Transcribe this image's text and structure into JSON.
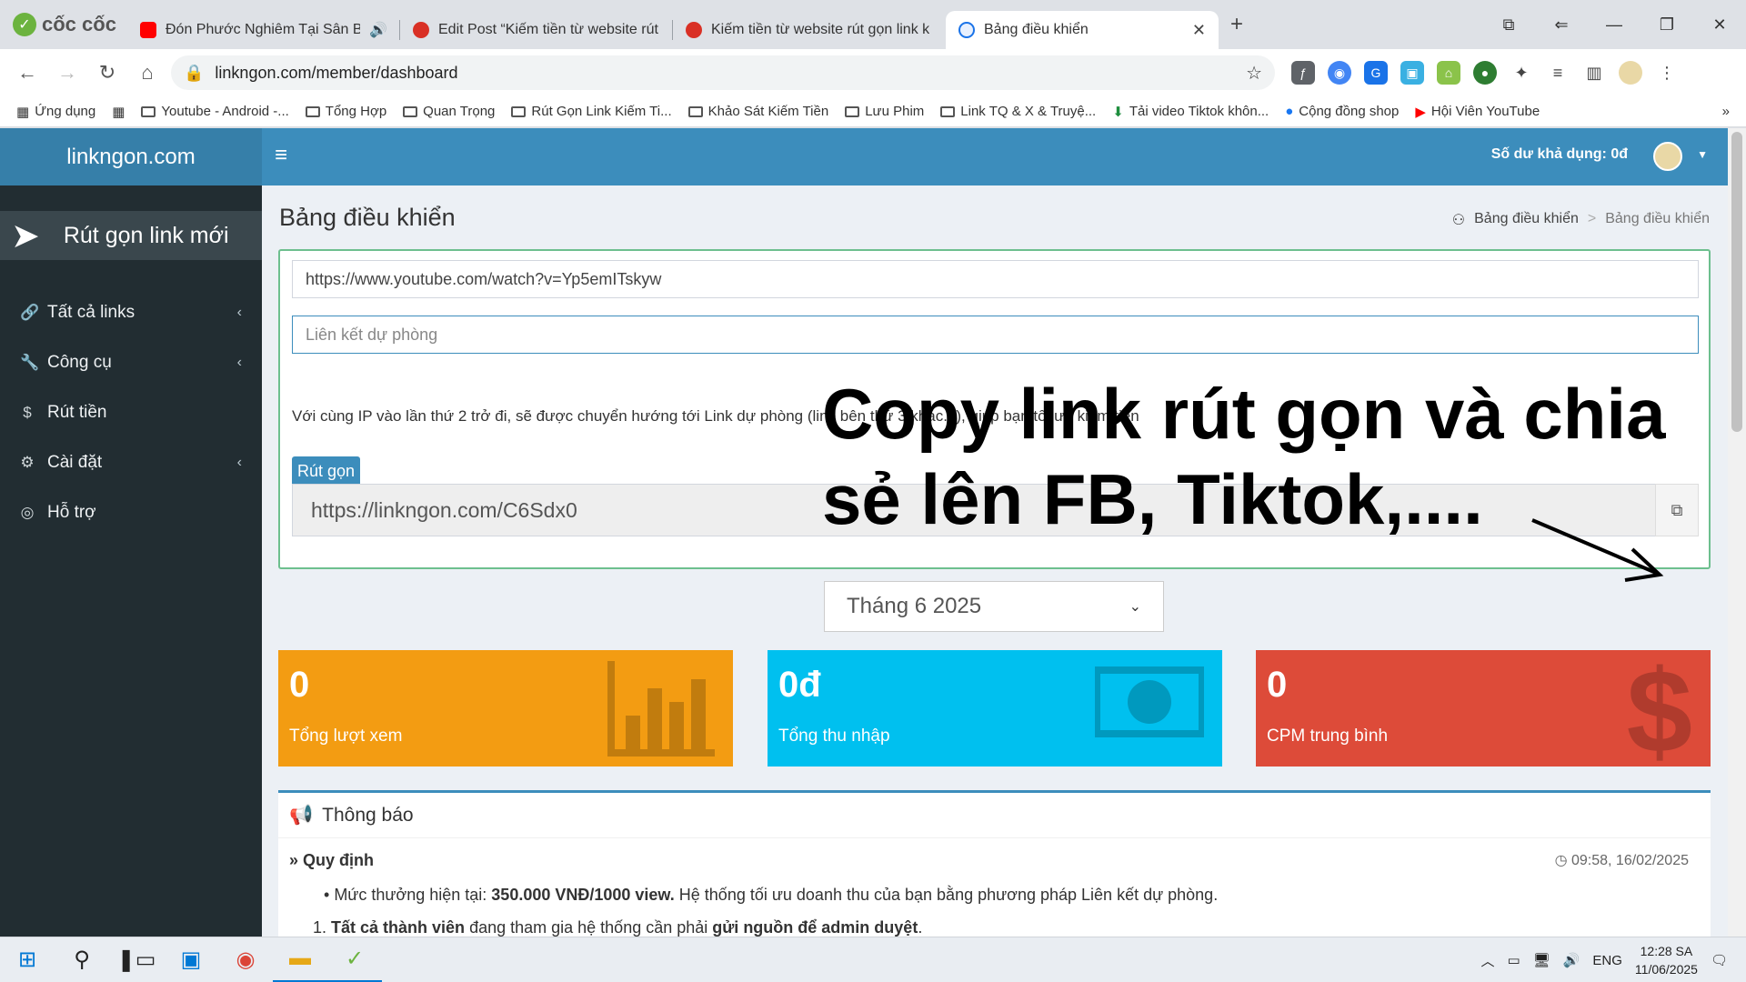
{
  "browser": {
    "logo_text": "cốc cốc",
    "tabs": [
      {
        "title": "Đón Phước Nghiêm Tại Sân Ba",
        "fav_color": "#ff0000"
      },
      {
        "title": "Edit Post “Kiếm tiền từ website rút",
        "fav_color": "#d93025"
      },
      {
        "title": "Kiếm tiền từ website rút gọn link k",
        "fav_color": "#d93025"
      },
      {
        "title": "Bảng điều khiển",
        "fav_color": "#1a73e8"
      }
    ],
    "url": "linkngon.com/member/dashboard",
    "bookmarks": [
      "Ứng dụng",
      "Youtube - Android -...",
      "Tổng Hợp",
      "Quan Trọng",
      "Rút Gọn Link Kiếm Ti...",
      "Khảo Sát Kiếm Tiền",
      "Lưu Phim",
      "Link TQ & X & Truyệ...",
      "Tải video Tiktok khôn...",
      "Cộng đồng shop",
      "Hội Viên YouTube"
    ]
  },
  "site": {
    "brand": "linkngon.com",
    "balance": "Số dư khả dụng: 0đ"
  },
  "sidebar": {
    "new_link": "Rút gọn link mới",
    "items": [
      {
        "label": "Tất cả links",
        "icon": "link-icon",
        "glyph": "🔗",
        "chevron": true
      },
      {
        "label": "Công cụ",
        "icon": "wrench-icon",
        "glyph": "🔧",
        "chevron": true
      },
      {
        "label": "Rút tiền",
        "icon": "dollar-icon",
        "glyph": "$",
        "chevron": false
      },
      {
        "label": "Cài đặt",
        "icon": "cogs-icon",
        "glyph": "⚙",
        "chevron": true
      },
      {
        "label": "Hỗ trợ",
        "icon": "lifebuoy-icon",
        "glyph": "◎",
        "chevron": false
      }
    ]
  },
  "main": {
    "title": "Bảng điều khiển",
    "breadcrumb_home": "Bảng điều khiển",
    "breadcrumb_current": "Bảng điều khiển",
    "long_url": "https://www.youtube.com/watch?v=Yp5emITskyw",
    "backup_placeholder": "Liên kết dự phòng",
    "note": "Với cùng IP vào lần thứ 2 trở đi, sẽ được chuyển hướng tới Link dự phòng (link bên thứ 3 khác...), giúp bạn tối ưu kiếm tiền",
    "shorten_label": "Rút gọn",
    "short_url": "https://linkngon.com/C6Sdx0",
    "overlay_line1": "Copy link rút gọn và chia",
    "overlay_line2": "sẻ lên FB, Tiktok,....",
    "month": "Tháng 6 2025"
  },
  "stats": [
    {
      "value": "0",
      "label": "Tổng lượt xem",
      "color": "#f39c12"
    },
    {
      "value": "0đ",
      "label": "Tổng thu nhập",
      "color": "#00c0ef"
    },
    {
      "value": "0",
      "label": "CPM trung bình",
      "color": "#dd4b39"
    }
  ],
  "notice": {
    "header": "Thông báo",
    "rule_title": "Quy định",
    "rule_time": "09:58, 16/02/2025",
    "line1_prefix": "Mức thưởng hiện tại: ",
    "line1_bold": "350.000 VNĐ/1000 view.",
    "line1_suffix": " Hệ thống tối ưu doanh thu của bạn bằng phương pháp Liên kết dự phòng.",
    "line2_num": "1. ",
    "line2_bold1": "Tất cả thành viên",
    "line2_mid": " đang tham gia hệ thống cần phải ",
    "line2_bold2": "gửi nguồn để admin duyệt",
    "line2_end": "."
  },
  "taskbar": {
    "lang": "ENG",
    "time": "12:28 SA",
    "date": "11/06/2025"
  }
}
